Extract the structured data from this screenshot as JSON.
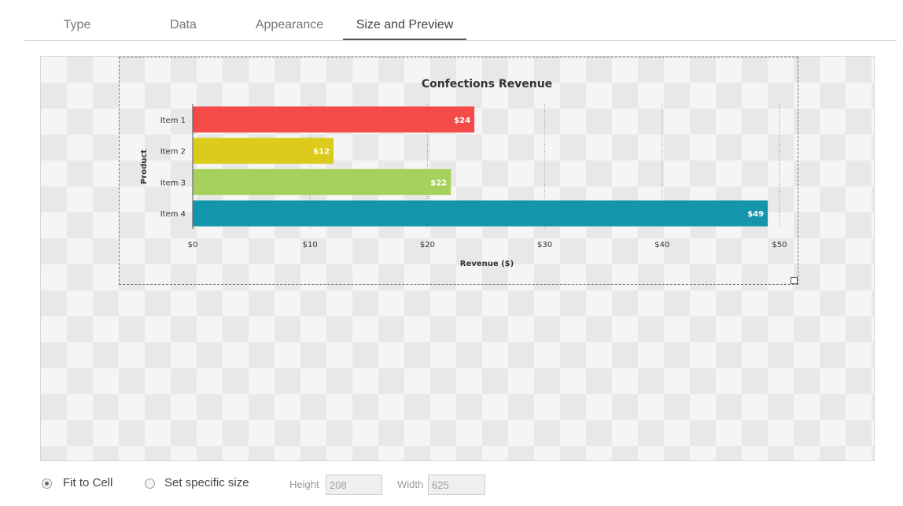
{
  "tabs": [
    {
      "label": "Type",
      "active": false
    },
    {
      "label": "Data",
      "active": false
    },
    {
      "label": "Appearance",
      "active": false
    },
    {
      "label": "Size and Preview",
      "active": true
    }
  ],
  "chart_data": {
    "type": "bar",
    "orientation": "horizontal",
    "title": "Confections Revenue",
    "xlabel": "Revenue ($)",
    "ylabel": "Product",
    "categories": [
      "Item 1",
      "Item 2",
      "Item 3",
      "Item 4"
    ],
    "values": [
      24,
      12,
      22,
      49
    ],
    "data_labels": [
      "$24",
      "$12",
      "$22",
      "$49"
    ],
    "colors": [
      "#f44b48",
      "#dccb1b",
      "#a6d15d",
      "#1396ab"
    ],
    "xlim": [
      0,
      50
    ],
    "ticks": [
      0,
      10,
      20,
      30,
      40,
      50
    ],
    "tick_labels": [
      "$0",
      "$10",
      "$20",
      "$30",
      "$40",
      "$50"
    ],
    "grid": "vertical dotted",
    "legend": "none"
  },
  "size_options": {
    "fit_to_cell_label": "Fit to Cell",
    "fit_to_cell_selected": true,
    "specific_size_label": "Set specific size",
    "specific_size_selected": false,
    "height_label": "Height",
    "height_value": "208",
    "width_label": "Width",
    "width_value": "625"
  }
}
